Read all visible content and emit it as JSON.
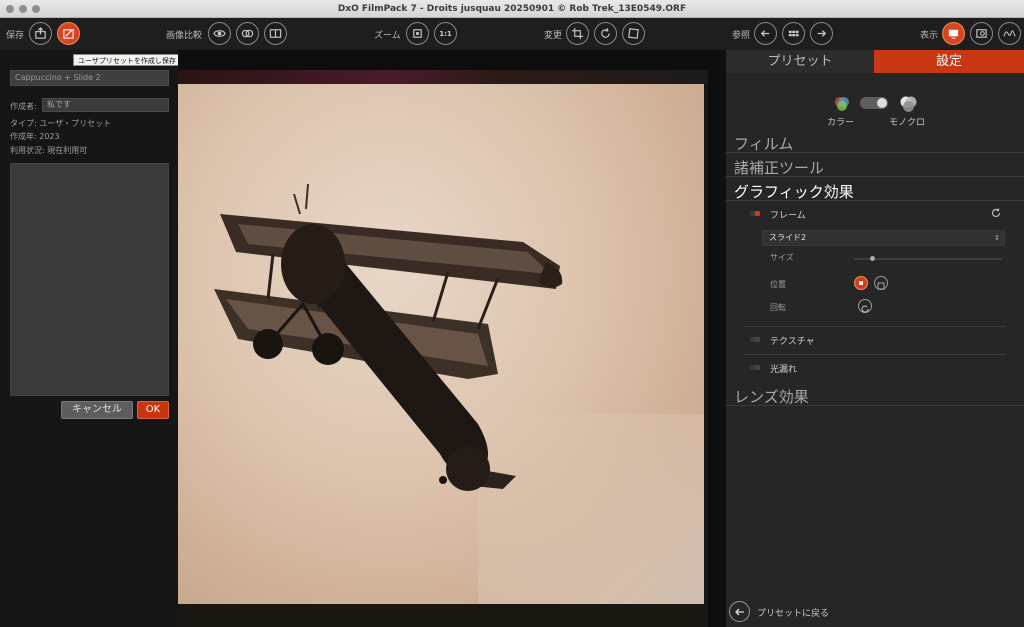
{
  "window": {
    "title": "DxO FilmPack 7 - Droits jusquau 20250901 © Rob Trek_13E0549.ORF"
  },
  "toolbar": {
    "save_label": "保存",
    "compare_label": "画像比較",
    "zoom_label": "ズーム",
    "zoom_100": "1:1",
    "transform_label": "変更",
    "browse_label": "参照",
    "display_label": "表示"
  },
  "tooltip": "ユーザプリセットを作成し保存 (⇧⌘S)",
  "preset_editor": {
    "name_value": "Cappuccino + Slide 2",
    "author_label": "作成者:",
    "author_value": "私です",
    "type_line": "タイプ: ユーザ・プリセット",
    "year_line": "作成年: 2023",
    "status_line": "利用状況: 現在利用可",
    "cancel": "キャンセル",
    "ok": "OK"
  },
  "right_panel": {
    "tabs": {
      "presets": "プリセット",
      "settings": "設定"
    },
    "color_label": "カラー",
    "mono_label": "モノクロ",
    "sections": {
      "film": "フィルム",
      "tools": "諸補正ツール",
      "graphic": "グラフィック効果",
      "lens": "レンズ効果"
    },
    "frame": {
      "label": "フレーム",
      "selected": "スライド2",
      "size_label": "サイズ",
      "position_label": "位置",
      "rotation_label": "回転"
    },
    "texture_label": "テクスチャ",
    "light_leak_label": "光漏れ",
    "back_label": "プリセットに戻る"
  },
  "colors": {
    "accent": "#c73813",
    "panel": "#262626"
  }
}
